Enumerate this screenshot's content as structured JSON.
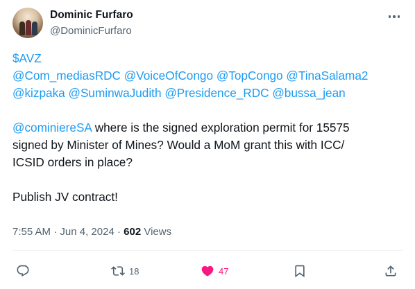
{
  "author": {
    "name": "Dominic Furfaro",
    "handle": "@DominicFurfaro"
  },
  "tweet": {
    "cashtag": "$AVZ",
    "mentions_line1": [
      "@Com_mediasRDC",
      "@VoiceOfCongo",
      "@TopCongo",
      "@TinaSalama2"
    ],
    "mentions_line2": [
      "@kizpaka",
      "@SuminwaJudith",
      "@Presidence_RDC",
      "@bussa_jean"
    ],
    "reply_mention": "@cominiereSA",
    "text_line1": " where is the signed exploration permit for 15575",
    "text_line2": "signed by Minister of Mines? Would a MoM grant this with ICC/",
    "text_line3": "ICSID orders in place?",
    "closing": "Publish JV contract!"
  },
  "meta": {
    "time": "7:55 AM",
    "separator": " · ",
    "date": "Jun 4, 2024",
    "views_count": "602",
    "views_label": " Views"
  },
  "actions": {
    "retweets": "18",
    "likes": "47"
  },
  "colors": {
    "link": "#1d9bf0",
    "like": "#f91880",
    "secondary_text": "#536471"
  },
  "icons": [
    "more-icon",
    "reply-icon",
    "retweet-icon",
    "heart-icon",
    "bookmark-icon",
    "share-icon"
  ]
}
